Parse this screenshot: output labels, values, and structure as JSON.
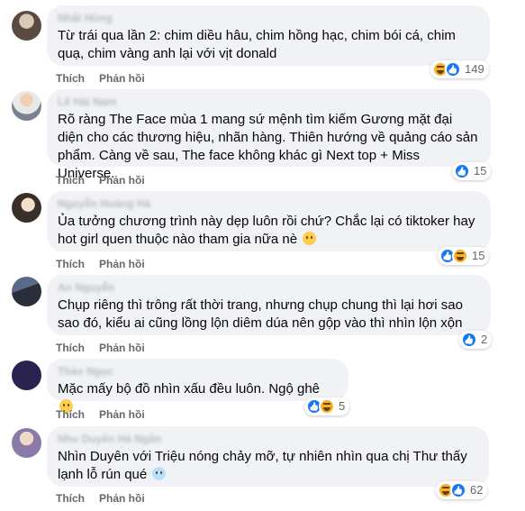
{
  "actions": {
    "like_label": "Thích",
    "reply_label": "Phản hồi"
  },
  "colors": {
    "like_blue": "#1877f2",
    "haha_yellow": "#f7b125",
    "bubble_bg": "#f0f2f5"
  },
  "comments": [
    {
      "author": "Nhật Hùng",
      "text": "Từ trái qua lần 2: chim diều hâu, chim hồng hạc, chim bói cá, chim quạ, chim vàng anh lại với vịt donald",
      "reactions": [
        "haha-icon",
        "like-icon"
      ],
      "count": "149"
    },
    {
      "author": "Lê Hải Nam",
      "text": "Rõ ràng The Face mùa 1 mang sứ mệnh tìm kiếm Gương mặt đại diện cho các thương hiệu, nhãn hàng. Thiên hướng về quảng cáo sản phẩm. Càng về sau, The face không khác gì Next top + Miss Universe.",
      "reactions": [
        "like-icon"
      ],
      "count": "15"
    },
    {
      "author": "Nguyễn Hoàng Hà",
      "text": "Ủa tưởng chương trình này dẹp luôn rồi chứ? Chắc lại có tiktoker hay hot girl quen thuộc nào tham gia nữa nè",
      "emoji": "grin-sweat-emoji",
      "reactions": [
        "like-icon",
        "haha-icon"
      ],
      "count": "15"
    },
    {
      "author": "An Nguyễn",
      "text": "Chụp riêng thì trông rất thời trang, nhưng chụp chung thì lại hơi sao sao đó, kiểu ai cũng lồng lộn diêm dúa nên gộp vào thì nhìn lộn xộn",
      "reactions": [
        "like-icon"
      ],
      "count": "2"
    },
    {
      "author": "Thảo Ngọc",
      "text": "Mặc mấy bộ đồ nhìn xấu đều luôn. Ngộ ghê",
      "emoji": "laughing-emoji",
      "reactions": [
        "like-icon",
        "haha-icon"
      ],
      "count": "5"
    },
    {
      "author": "Nhu Duyên Hà Ngân",
      "text": "Nhìn Duyên với Triệu nóng chảy mỡ, tự nhiên nhìn qua chị Thư thấy lạnh lỗ rún qué",
      "emoji": "cold-face-emoji",
      "reactions": [
        "haha-icon",
        "like-icon"
      ],
      "count": "62"
    }
  ]
}
